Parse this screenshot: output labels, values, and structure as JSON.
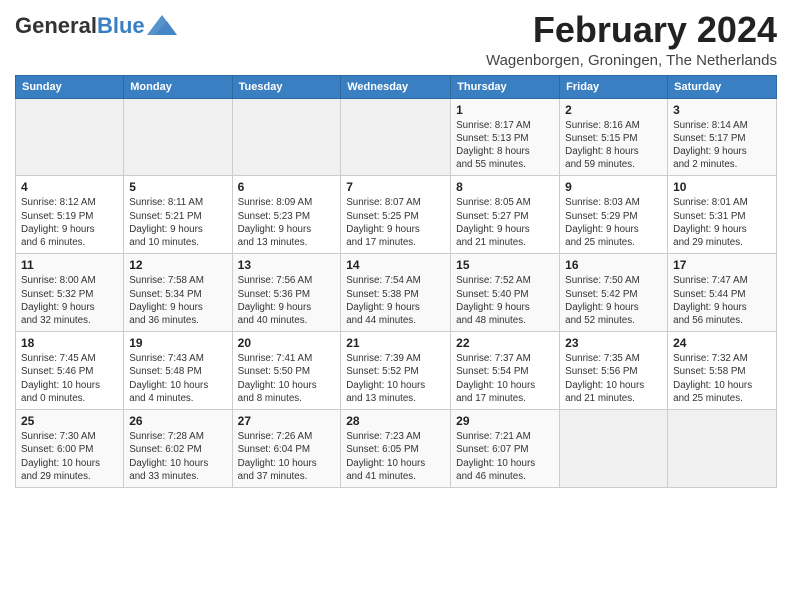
{
  "header": {
    "logo_general": "General",
    "logo_blue": "Blue",
    "month_title": "February 2024",
    "location": "Wagenborgen, Groningen, The Netherlands"
  },
  "days_of_week": [
    "Sunday",
    "Monday",
    "Tuesday",
    "Wednesday",
    "Thursday",
    "Friday",
    "Saturday"
  ],
  "weeks": [
    [
      {
        "day": "",
        "info": ""
      },
      {
        "day": "",
        "info": ""
      },
      {
        "day": "",
        "info": ""
      },
      {
        "day": "",
        "info": ""
      },
      {
        "day": "1",
        "info": "Sunrise: 8:17 AM\nSunset: 5:13 PM\nDaylight: 8 hours\nand 55 minutes."
      },
      {
        "day": "2",
        "info": "Sunrise: 8:16 AM\nSunset: 5:15 PM\nDaylight: 8 hours\nand 59 minutes."
      },
      {
        "day": "3",
        "info": "Sunrise: 8:14 AM\nSunset: 5:17 PM\nDaylight: 9 hours\nand 2 minutes."
      }
    ],
    [
      {
        "day": "4",
        "info": "Sunrise: 8:12 AM\nSunset: 5:19 PM\nDaylight: 9 hours\nand 6 minutes."
      },
      {
        "day": "5",
        "info": "Sunrise: 8:11 AM\nSunset: 5:21 PM\nDaylight: 9 hours\nand 10 minutes."
      },
      {
        "day": "6",
        "info": "Sunrise: 8:09 AM\nSunset: 5:23 PM\nDaylight: 9 hours\nand 13 minutes."
      },
      {
        "day": "7",
        "info": "Sunrise: 8:07 AM\nSunset: 5:25 PM\nDaylight: 9 hours\nand 17 minutes."
      },
      {
        "day": "8",
        "info": "Sunrise: 8:05 AM\nSunset: 5:27 PM\nDaylight: 9 hours\nand 21 minutes."
      },
      {
        "day": "9",
        "info": "Sunrise: 8:03 AM\nSunset: 5:29 PM\nDaylight: 9 hours\nand 25 minutes."
      },
      {
        "day": "10",
        "info": "Sunrise: 8:01 AM\nSunset: 5:31 PM\nDaylight: 9 hours\nand 29 minutes."
      }
    ],
    [
      {
        "day": "11",
        "info": "Sunrise: 8:00 AM\nSunset: 5:32 PM\nDaylight: 9 hours\nand 32 minutes."
      },
      {
        "day": "12",
        "info": "Sunrise: 7:58 AM\nSunset: 5:34 PM\nDaylight: 9 hours\nand 36 minutes."
      },
      {
        "day": "13",
        "info": "Sunrise: 7:56 AM\nSunset: 5:36 PM\nDaylight: 9 hours\nand 40 minutes."
      },
      {
        "day": "14",
        "info": "Sunrise: 7:54 AM\nSunset: 5:38 PM\nDaylight: 9 hours\nand 44 minutes."
      },
      {
        "day": "15",
        "info": "Sunrise: 7:52 AM\nSunset: 5:40 PM\nDaylight: 9 hours\nand 48 minutes."
      },
      {
        "day": "16",
        "info": "Sunrise: 7:50 AM\nSunset: 5:42 PM\nDaylight: 9 hours\nand 52 minutes."
      },
      {
        "day": "17",
        "info": "Sunrise: 7:47 AM\nSunset: 5:44 PM\nDaylight: 9 hours\nand 56 minutes."
      }
    ],
    [
      {
        "day": "18",
        "info": "Sunrise: 7:45 AM\nSunset: 5:46 PM\nDaylight: 10 hours\nand 0 minutes."
      },
      {
        "day": "19",
        "info": "Sunrise: 7:43 AM\nSunset: 5:48 PM\nDaylight: 10 hours\nand 4 minutes."
      },
      {
        "day": "20",
        "info": "Sunrise: 7:41 AM\nSunset: 5:50 PM\nDaylight: 10 hours\nand 8 minutes."
      },
      {
        "day": "21",
        "info": "Sunrise: 7:39 AM\nSunset: 5:52 PM\nDaylight: 10 hours\nand 13 minutes."
      },
      {
        "day": "22",
        "info": "Sunrise: 7:37 AM\nSunset: 5:54 PM\nDaylight: 10 hours\nand 17 minutes."
      },
      {
        "day": "23",
        "info": "Sunrise: 7:35 AM\nSunset: 5:56 PM\nDaylight: 10 hours\nand 21 minutes."
      },
      {
        "day": "24",
        "info": "Sunrise: 7:32 AM\nSunset: 5:58 PM\nDaylight: 10 hours\nand 25 minutes."
      }
    ],
    [
      {
        "day": "25",
        "info": "Sunrise: 7:30 AM\nSunset: 6:00 PM\nDaylight: 10 hours\nand 29 minutes."
      },
      {
        "day": "26",
        "info": "Sunrise: 7:28 AM\nSunset: 6:02 PM\nDaylight: 10 hours\nand 33 minutes."
      },
      {
        "day": "27",
        "info": "Sunrise: 7:26 AM\nSunset: 6:04 PM\nDaylight: 10 hours\nand 37 minutes."
      },
      {
        "day": "28",
        "info": "Sunrise: 7:23 AM\nSunset: 6:05 PM\nDaylight: 10 hours\nand 41 minutes."
      },
      {
        "day": "29",
        "info": "Sunrise: 7:21 AM\nSunset: 6:07 PM\nDaylight: 10 hours\nand 46 minutes."
      },
      {
        "day": "",
        "info": ""
      },
      {
        "day": "",
        "info": ""
      }
    ]
  ]
}
